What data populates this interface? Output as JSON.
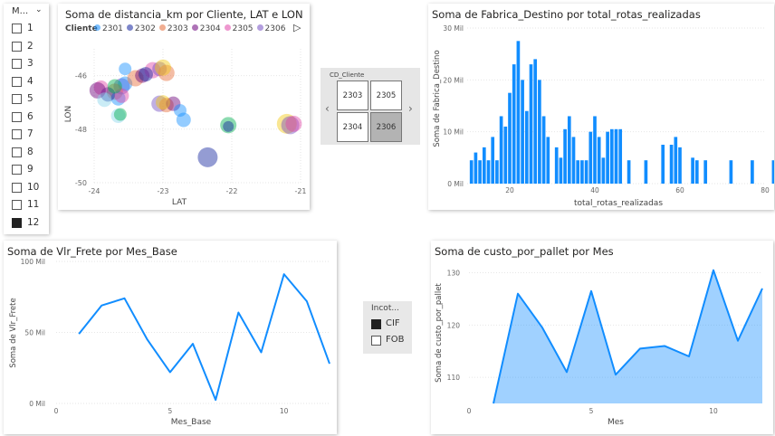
{
  "month_slicer": {
    "header": "M...",
    "items": [
      {
        "label": "1",
        "checked": false
      },
      {
        "label": "2",
        "checked": false
      },
      {
        "label": "3",
        "checked": false
      },
      {
        "label": "4",
        "checked": false
      },
      {
        "label": "5",
        "checked": false
      },
      {
        "label": "6",
        "checked": false
      },
      {
        "label": "7",
        "checked": false
      },
      {
        "label": "8",
        "checked": false
      },
      {
        "label": "9",
        "checked": false
      },
      {
        "label": "10",
        "checked": false
      },
      {
        "label": "11",
        "checked": false
      },
      {
        "label": "12",
        "checked": true
      }
    ]
  },
  "scatter": {
    "title": "Soma de distancia_km por Cliente, LAT e LON",
    "legend_title": "Cliente",
    "legend": [
      {
        "name": "2301",
        "color": "#118DFF"
      },
      {
        "name": "2302",
        "color": "#12239E"
      },
      {
        "name": "2303",
        "color": "#E66C37"
      },
      {
        "name": "2304",
        "color": "#6B007B"
      },
      {
        "name": "2305",
        "color": "#E044A7"
      },
      {
        "name": "2306",
        "color": "#744EC2"
      }
    ]
  },
  "client_slicer": {
    "header": "CD_Cliente",
    "buttons": [
      {
        "label": "2303",
        "selected": false
      },
      {
        "label": "2305",
        "selected": false
      },
      {
        "label": "2304",
        "selected": false
      },
      {
        "label": "2306",
        "selected": true
      }
    ]
  },
  "histogram": {
    "title": "Soma de Fabrica_Destino por total_rotas_realizadas"
  },
  "line_chart": {
    "title": "Soma de Vlr_Frete por Mes_Base"
  },
  "incoterm_slicer": {
    "header": "Incot...",
    "items": [
      {
        "label": "CIF",
        "checked": true
      },
      {
        "label": "FOB",
        "checked": false
      }
    ]
  },
  "area_chart": {
    "title": "Soma de custo_por_pallet por Mes"
  },
  "chart_data": [
    {
      "type": "scatter",
      "title": "Soma de distancia_km por Cliente, LAT e LON",
      "xlabel": "LAT",
      "ylabel": "LON",
      "xlim": [
        -24,
        -21
      ],
      "ylim": [
        -50,
        -45
      ],
      "xticks": [
        "-24",
        "-23",
        "-22",
        "-21"
      ],
      "yticks": [
        "-46",
        "-48",
        "-50"
      ],
      "points": [
        {
          "x": -23.6,
          "y": -46.4,
          "c": "#744EC2",
          "r": 9
        },
        {
          "x": -23.55,
          "y": -46.3,
          "c": "#118DFF",
          "r": 8
        },
        {
          "x": -23.4,
          "y": -46.1,
          "c": "#E66C37",
          "r": 9
        },
        {
          "x": -23.3,
          "y": -46.0,
          "c": "#6B007B",
          "r": 8
        },
        {
          "x": -23.15,
          "y": -45.8,
          "c": "#E044A7",
          "r": 9
        },
        {
          "x": -23.05,
          "y": -45.75,
          "c": "#744EC2",
          "r": 8
        },
        {
          "x": -22.95,
          "y": -45.9,
          "c": "#E66C37",
          "r": 9
        },
        {
          "x": -23.0,
          "y": -45.7,
          "c": "#F2C80F",
          "r": 9
        },
        {
          "x": -23.25,
          "y": -45.95,
          "c": "#12239E",
          "r": 8
        },
        {
          "x": -23.55,
          "y": -45.75,
          "c": "#118DFF",
          "r": 7
        },
        {
          "x": -23.7,
          "y": -46.6,
          "c": "#E66C37",
          "r": 9
        },
        {
          "x": -23.65,
          "y": -46.85,
          "c": "#118DFF",
          "r": 8
        },
        {
          "x": -23.8,
          "y": -46.7,
          "c": "#12239E",
          "r": 8
        },
        {
          "x": -23.9,
          "y": -46.45,
          "c": "#E044A7",
          "r": 8
        },
        {
          "x": -23.95,
          "y": -46.55,
          "c": "#6B007B",
          "r": 9
        },
        {
          "x": -23.85,
          "y": -46.9,
          "c": "#8AD4EB",
          "r": 8
        },
        {
          "x": -23.6,
          "y": -46.75,
          "c": "#E044A7",
          "r": 8
        },
        {
          "x": -23.7,
          "y": -46.4,
          "c": "#00B050",
          "r": 8
        },
        {
          "x": -23.65,
          "y": -47.5,
          "c": "#8AD4EB",
          "r": 8
        },
        {
          "x": -23.62,
          "y": -47.45,
          "c": "#00B050",
          "r": 7
        },
        {
          "x": -23.05,
          "y": -47.05,
          "c": "#744EC2",
          "r": 9
        },
        {
          "x": -22.95,
          "y": -47.1,
          "c": "#E66C37",
          "r": 8
        },
        {
          "x": -22.85,
          "y": -47.05,
          "c": "#6B007B",
          "r": 8
        },
        {
          "x": -23.0,
          "y": -47.0,
          "c": "#F2C80F",
          "r": 8
        },
        {
          "x": -22.75,
          "y": -47.3,
          "c": "#118DFF",
          "r": 7
        },
        {
          "x": -22.7,
          "y": -47.65,
          "c": "#118DFF",
          "r": 8
        },
        {
          "x": -22.05,
          "y": -47.85,
          "c": "#00B050",
          "r": 9
        },
        {
          "x": -22.05,
          "y": -47.9,
          "c": "#12239E",
          "r": 6
        },
        {
          "x": -21.2,
          "y": -47.8,
          "c": "#F2C80F",
          "r": 11
        },
        {
          "x": -21.15,
          "y": -47.85,
          "c": "#744EC2",
          "r": 10
        },
        {
          "x": -21.1,
          "y": -47.8,
          "c": "#E044A7",
          "r": 9
        },
        {
          "x": -22.35,
          "y": -49.05,
          "c": "#12239E",
          "r": 11
        }
      ]
    },
    {
      "type": "bar",
      "title": "Soma de Fabrica_Destino por total_rotas_realizadas",
      "xlabel": "total_rotas_realizadas",
      "ylabel": "Soma de Fabrica_Destino",
      "xlim": [
        10,
        80
      ],
      "ylim": [
        0,
        30000
      ],
      "xticks": [
        20,
        40,
        60,
        80
      ],
      "yticks": [
        "0 Mil",
        "10 Mil",
        "20 Mil",
        "30 Mil"
      ],
      "x": [
        11,
        12,
        13,
        14,
        15,
        16,
        17,
        18,
        19,
        20,
        21,
        22,
        23,
        24,
        25,
        26,
        27,
        28,
        29,
        31,
        32,
        33,
        34,
        35,
        36,
        37,
        38,
        39,
        40,
        41,
        42,
        43,
        44,
        45,
        46,
        48,
        52,
        56,
        58,
        59,
        60,
        63,
        64,
        66,
        72,
        77,
        82
      ],
      "values": [
        4500,
        6000,
        4500,
        7000,
        4500,
        9000,
        4500,
        13000,
        11000,
        17500,
        23000,
        27500,
        20000,
        14000,
        23000,
        24000,
        20000,
        13000,
        9000,
        7000,
        5000,
        10500,
        13000,
        9000,
        4500,
        4500,
        4500,
        10000,
        13000,
        9000,
        5000,
        10000,
        10500,
        10500,
        10500,
        4500,
        4500,
        7500,
        7500,
        9000,
        7000,
        5000,
        4500,
        4500,
        4500,
        4500,
        4500
      ]
    },
    {
      "type": "line",
      "title": "Soma de Vlr_Frete por Mes_Base",
      "xlabel": "Mes_Base",
      "ylabel": "Soma de Vlr_Frete",
      "xlim": [
        0,
        12
      ],
      "ylim": [
        0,
        100000
      ],
      "xticks": [
        0,
        5,
        10
      ],
      "yticks": [
        "0 Mil",
        "50 Mil",
        "100 Mil"
      ],
      "x": [
        1,
        2,
        3,
        4,
        5,
        6,
        7,
        8,
        9,
        10,
        11,
        12
      ],
      "values": [
        49000,
        69000,
        74000,
        45000,
        22000,
        42000,
        2500,
        64000,
        36000,
        91000,
        72000,
        28000
      ]
    },
    {
      "type": "area",
      "title": "Soma de custo_por_pallet por Mes",
      "xlabel": "Mes",
      "ylabel": "Soma de custo_por_pallet",
      "xlim": [
        0,
        12
      ],
      "ylim": [
        105,
        132
      ],
      "xticks": [
        0,
        5,
        10
      ],
      "yticks": [
        110,
        120,
        130
      ],
      "x": [
        1,
        2,
        3,
        4,
        5,
        6,
        7,
        8,
        9,
        10,
        11,
        12
      ],
      "values": [
        104.5,
        126,
        119.5,
        111,
        126.5,
        110.5,
        115.5,
        116,
        114,
        130.5,
        117,
        127
      ]
    }
  ]
}
